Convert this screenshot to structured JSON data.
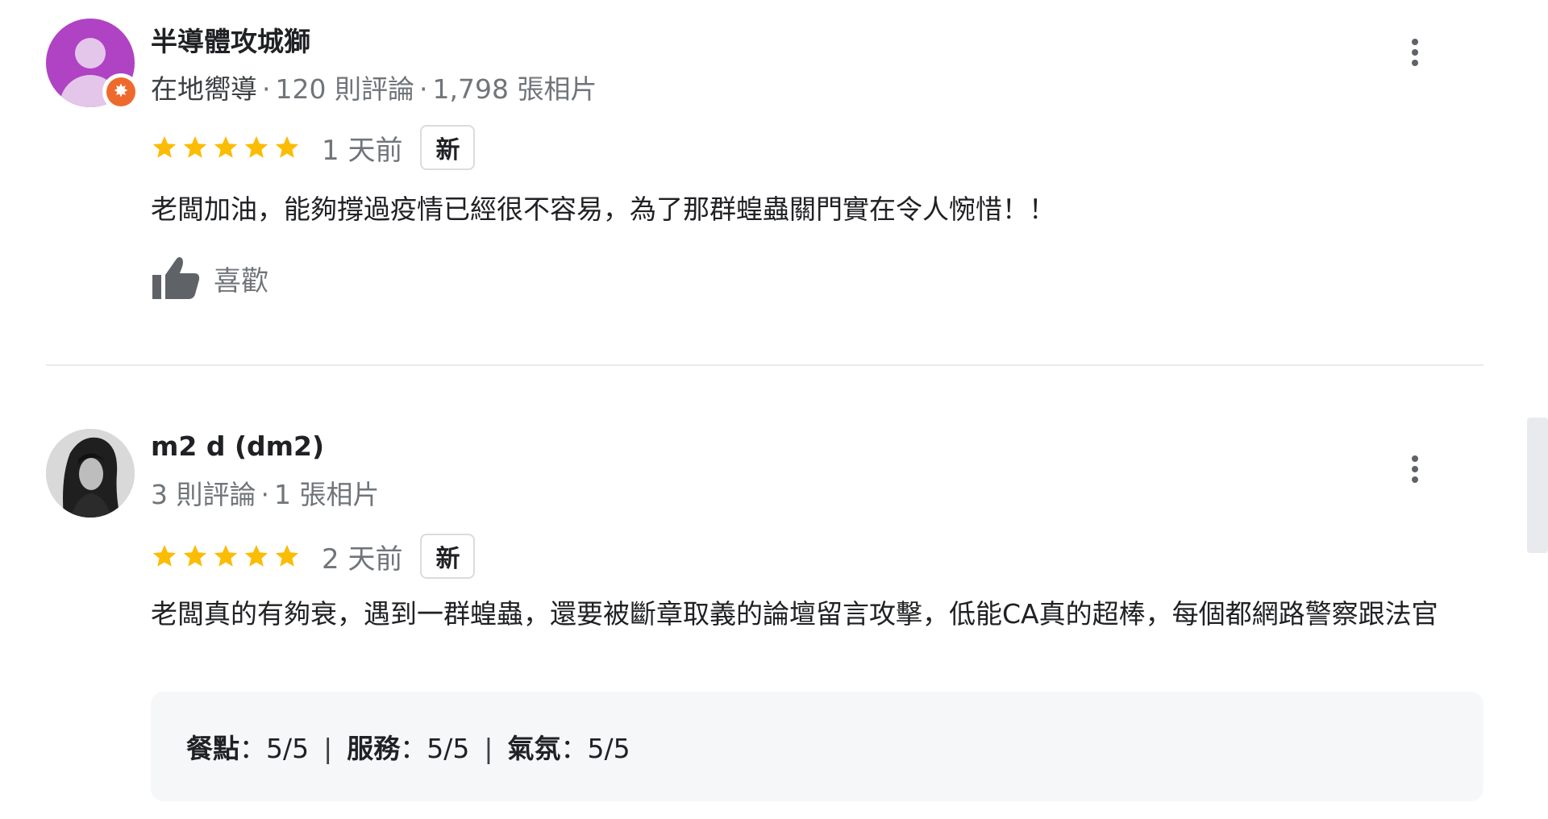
{
  "reviews": [
    {
      "author": "半導體攻城獅",
      "guide_label": "在地嚮導",
      "review_count": "120 則評論",
      "photo_count": "1,798 張相片",
      "rating": 5,
      "date": "1 天前",
      "badge": "新",
      "text": "老闆加油，能夠撐過疫情已經很不容易，為了那群蝗蟲關門實在令人惋惜！！",
      "like_label": "喜歡",
      "avatar_icon": "default-person-avatar",
      "avatar_color": "#b042c4",
      "badge_icon": "local-guide-badge-icon"
    },
    {
      "author": "m2 d (dm2)",
      "review_count": "3 則評論",
      "photo_count": "1 張相片",
      "rating": 5,
      "date": "2 天前",
      "badge": "新",
      "text": "老闆真的有夠衰，遇到一群蝗蟲，還要被斷章取義的論壇留言攻擊，低能CA真的超棒，每個都網路警察跟法官",
      "details": [
        {
          "key": "餐點",
          "value": "5/5"
        },
        {
          "key": "服務",
          "value": "5/5"
        },
        {
          "key": "氣氛",
          "value": "5/5"
        }
      ],
      "avatar_icon": "profile-photo-avatar"
    }
  ],
  "colors": {
    "star": "#fbbc04",
    "secondary_text": "#70757a",
    "primary_text": "#202124",
    "guide_badge": "#ee6a2c"
  },
  "icons": {
    "more": "more-vert-icon",
    "like": "thumb-up-icon",
    "star": "star-icon"
  }
}
